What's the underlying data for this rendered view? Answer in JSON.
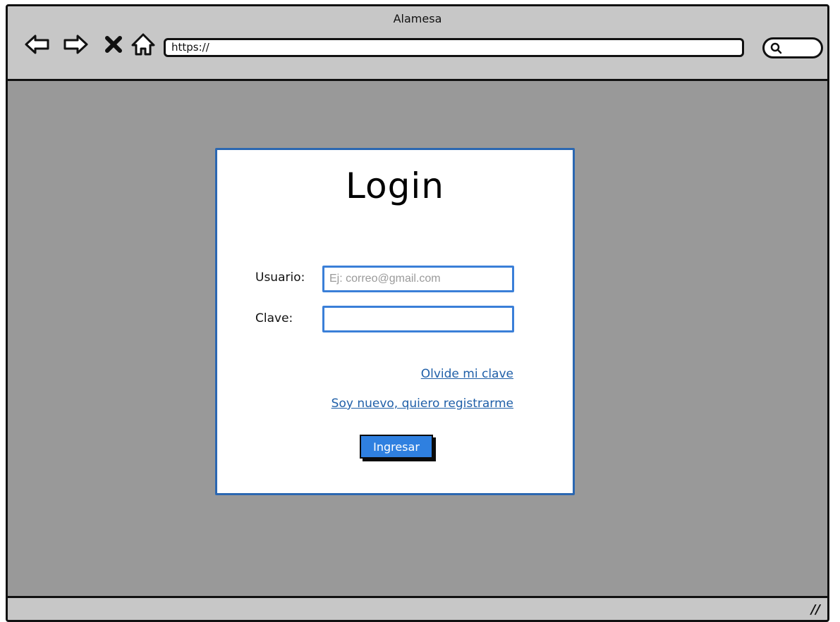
{
  "window": {
    "title": "Alamesa"
  },
  "toolbar": {
    "back_icon": "arrow-left-icon",
    "forward_icon": "arrow-right-icon",
    "stop_icon": "close-icon",
    "home_icon": "home-icon",
    "url": "https://",
    "search_icon": "search-icon"
  },
  "login": {
    "title": "Login",
    "user_label": "Usuario:",
    "user_placeholder": "Ej: correo@gmail.com",
    "user_value": "",
    "password_label": "Clave:",
    "password_value": "",
    "forgot_link": "Olvide mi clave",
    "register_link": "Soy nuevo, quiero registrarme",
    "submit_label": "Ingresar"
  },
  "colors": {
    "chrome": "#c7c7c7",
    "background": "#999999",
    "card_border": "#2b67b1",
    "input_border": "#3a7fd8",
    "link": "#1f5fa8",
    "button": "#2f80e0"
  }
}
